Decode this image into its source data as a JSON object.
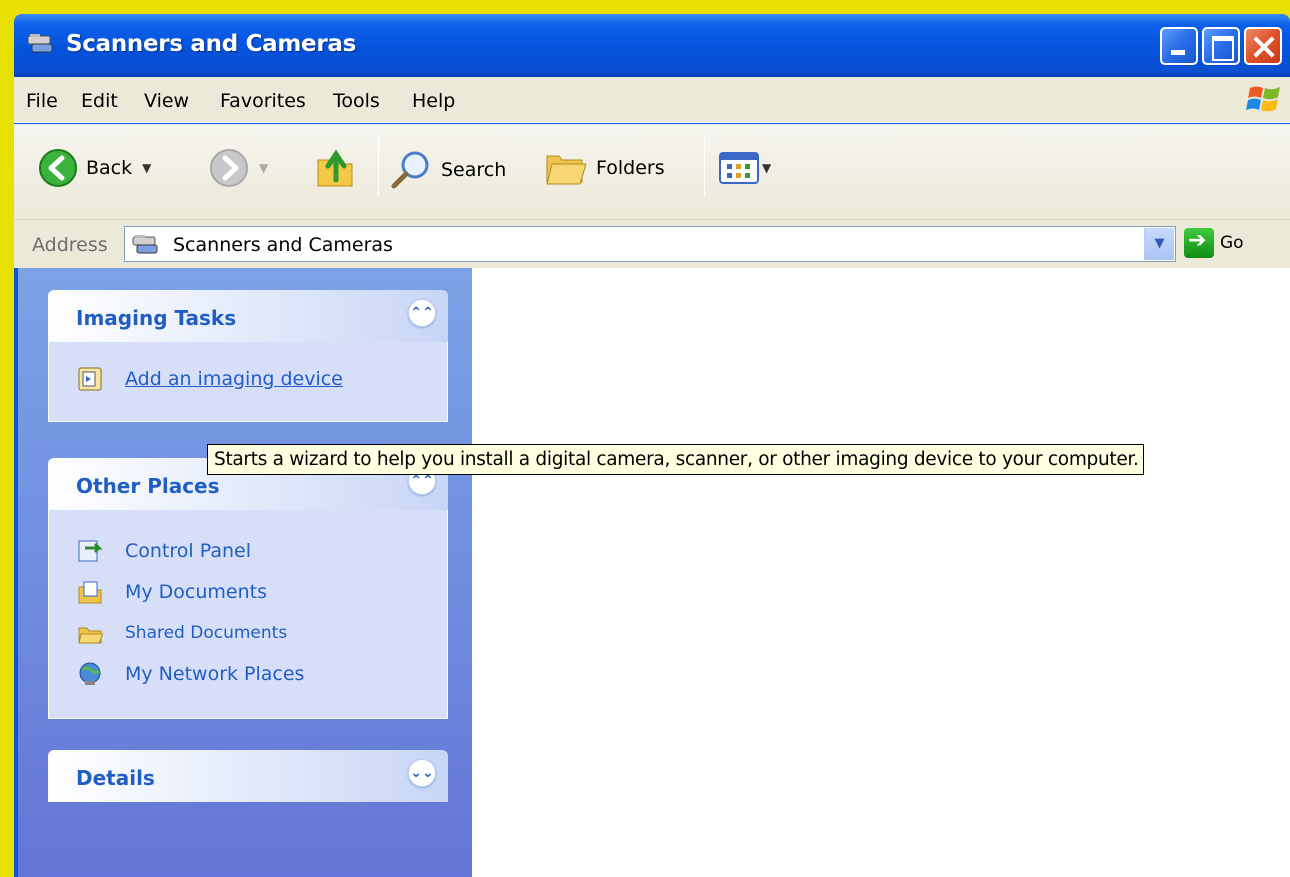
{
  "window": {
    "title": "Scanners and Cameras",
    "title_icon": "scanner-camera-icon"
  },
  "menu": {
    "items": [
      "File",
      "Edit",
      "View",
      "Favorites",
      "Tools",
      "Help"
    ]
  },
  "toolbar": {
    "back_label": "Back",
    "search_label": "Search",
    "folders_label": "Folders"
  },
  "address": {
    "label": "Address",
    "value": "Scanners and Cameras",
    "go_label": "Go"
  },
  "imaging_tasks": {
    "title": "Imaging Tasks",
    "items": [
      {
        "label": "Add an imaging device",
        "icon": "add-device-icon"
      }
    ]
  },
  "other_places": {
    "title": "Other Places",
    "items": [
      {
        "label": "Control Panel",
        "icon": "control-panel-icon"
      },
      {
        "label": "My Documents",
        "icon": "my-documents-icon"
      },
      {
        "label": "Shared Documents",
        "icon": "folder-icon"
      },
      {
        "label": "My Network Places",
        "icon": "network-places-icon"
      }
    ]
  },
  "details": {
    "title": "Details"
  },
  "tooltip": {
    "text": "Starts a wizard to help you install a digital camera, scanner, or other imaging device to your computer."
  },
  "colors": {
    "titlebar": "#0552da",
    "taskpane": "#7ba2e7",
    "link": "#215dc6",
    "tooltip_bg": "#ffffe1",
    "desktop_bg": "#e8e000"
  }
}
